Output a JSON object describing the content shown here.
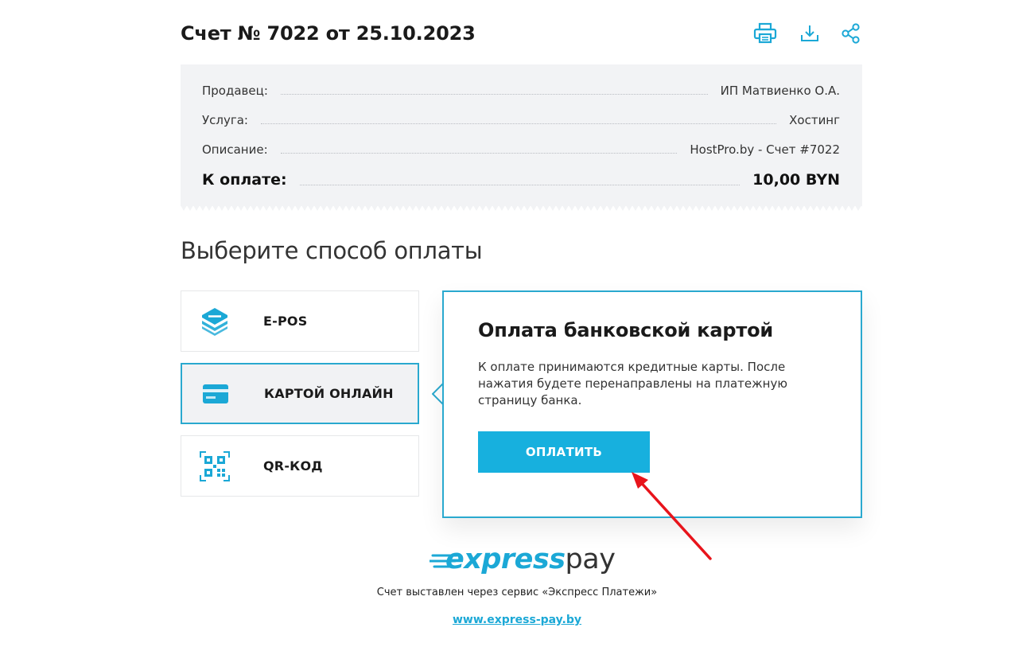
{
  "invoice": {
    "title": "Счет № 7022 от 25.10.2023"
  },
  "toolbar": {
    "print_icon": "printer-icon",
    "download_icon": "download-icon",
    "share_icon": "share-icon"
  },
  "summary": {
    "rows": [
      {
        "label": "Продавец:",
        "value": "ИП Матвиенко О.А."
      },
      {
        "label": "Услуга:",
        "value": "Хостинг"
      },
      {
        "label": "Описание:",
        "value": "HostPro.by - Счет #7022"
      }
    ],
    "total": {
      "label": "К оплате:",
      "value": "10,00 BYN"
    }
  },
  "payment": {
    "heading": "Выберите способ оплаты",
    "methods": [
      {
        "label": "E-POS",
        "icon": "epos-icon",
        "active": false
      },
      {
        "label": "КАРТОЙ ОНЛАЙН",
        "icon": "credit-card-icon",
        "active": true
      },
      {
        "label": "QR-КОД",
        "icon": "qr-code-icon",
        "active": false
      }
    ],
    "panel": {
      "title": "Оплата банковской картой",
      "text": "К оплате принимаются кредитные карты. После нажатия будете перенаправлены на платежную страницу банка.",
      "button": "ОПЛАТИТЬ"
    }
  },
  "footer": {
    "logo_express": "express",
    "logo_pay": "pay",
    "service_text": "Счет выставлен через сервис «Экспресс Платежи»",
    "site_link": "www.express-pay.by"
  },
  "colors": {
    "accent": "#17b0de",
    "border_active": "#2aa9cf",
    "summary_bg": "#f2f3f5",
    "annotation_arrow": "#e8141b"
  }
}
